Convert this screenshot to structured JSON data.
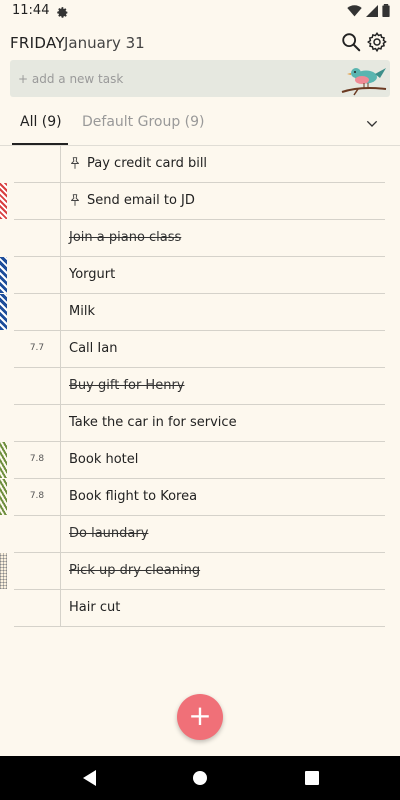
{
  "status_bar": {
    "time": "11:44"
  },
  "header": {
    "day": "FRIDAY",
    "date": "January 31"
  },
  "add_task": {
    "placeholder": "+ add a new task"
  },
  "tabs": [
    {
      "label": "All (9)",
      "active": true
    },
    {
      "label": "Default Group (9)",
      "active": false
    }
  ],
  "tasks": [
    {
      "label": "Pay credit card bill",
      "meta": "",
      "done": false,
      "pinned": true,
      "marker": ""
    },
    {
      "label": "Send email to JD",
      "meta": "",
      "done": false,
      "pinned": true,
      "marker": "red"
    },
    {
      "label": "Join a piano class",
      "meta": "",
      "done": true,
      "pinned": false,
      "marker": ""
    },
    {
      "label": "Yorgurt",
      "meta": "",
      "done": false,
      "pinned": false,
      "marker": "blue"
    },
    {
      "label": "Milk",
      "meta": "",
      "done": false,
      "pinned": false,
      "marker": "blue"
    },
    {
      "label": "Call Ian",
      "meta": "7.7",
      "done": false,
      "pinned": false,
      "marker": ""
    },
    {
      "label": "Buy gift for Henry",
      "meta": "",
      "done": true,
      "pinned": false,
      "marker": ""
    },
    {
      "label": "Take the car in for service",
      "meta": "",
      "done": false,
      "pinned": false,
      "marker": ""
    },
    {
      "label": "Book hotel",
      "meta": "7.8",
      "done": false,
      "pinned": false,
      "marker": "green"
    },
    {
      "label": "Book flight to Korea",
      "meta": "7.8",
      "done": false,
      "pinned": false,
      "marker": "green"
    },
    {
      "label": "Do laundary",
      "meta": "",
      "done": true,
      "pinned": false,
      "marker": ""
    },
    {
      "label": "Pick up dry cleaning",
      "meta": "",
      "done": true,
      "pinned": false,
      "marker": "gray"
    },
    {
      "label": "Hair cut",
      "meta": "",
      "done": false,
      "pinned": false,
      "marker": ""
    }
  ],
  "fab": {
    "symbol": "+"
  },
  "colors": {
    "background": "#fdf8ee",
    "accent": "#f07078",
    "add_bar": "#e6e8e0"
  },
  "icons": [
    "settings-gear-icon",
    "wifi-icon",
    "signal-icon",
    "battery-icon",
    "search-icon",
    "settings-icon",
    "bird-icon",
    "chevron-down-icon",
    "pin-icon",
    "add-icon",
    "back-icon",
    "home-icon",
    "recents-icon"
  ]
}
